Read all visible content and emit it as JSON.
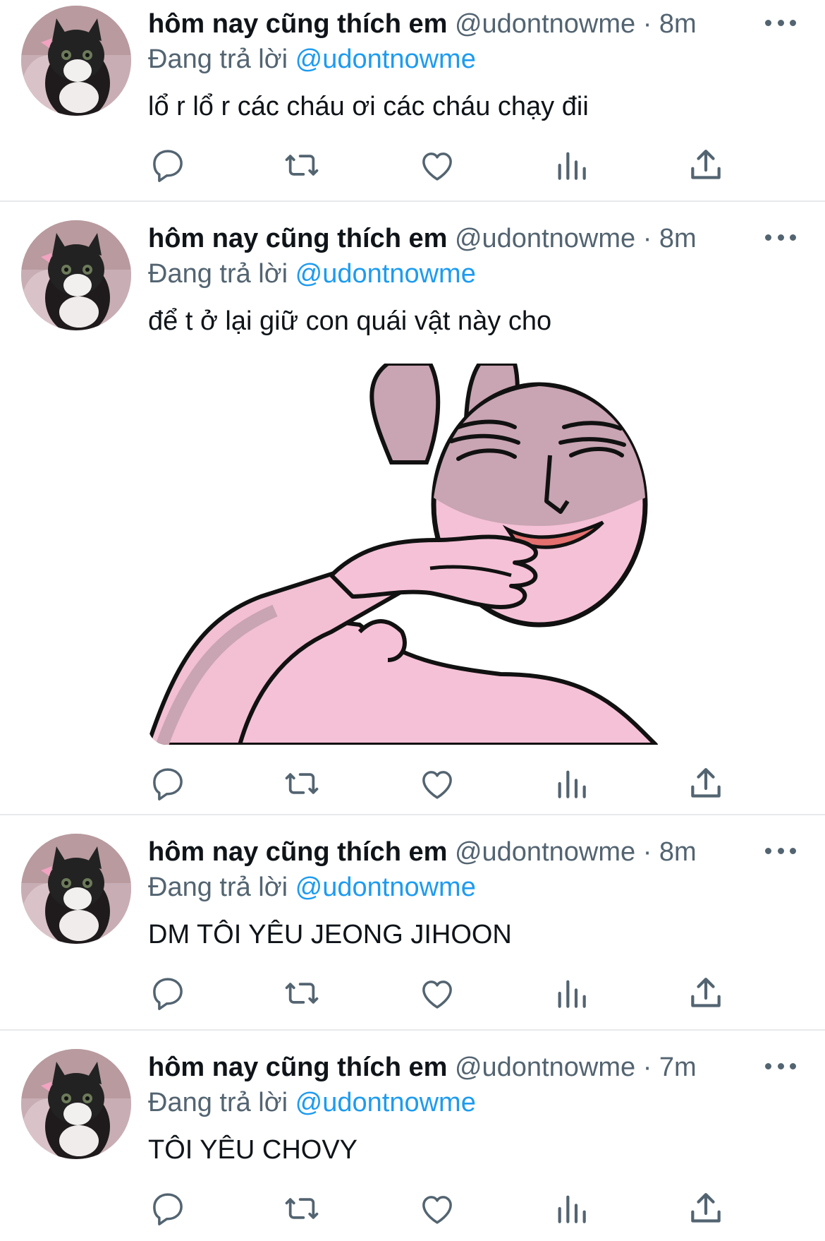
{
  "tweets": [
    {
      "display_name": "hôm nay cũng thích em",
      "handle": "@udontnowme",
      "separator": "·",
      "time": "8m",
      "replying_prefix": "Đang trả lời",
      "replying_to": "@udontnowme",
      "text": "lổ r lổ r các cháu ơi các cháu chạy đii",
      "has_media": false
    },
    {
      "display_name": "hôm nay cũng thích em",
      "handle": "@udontnowme",
      "separator": "·",
      "time": "8m",
      "replying_prefix": "Đang trả lời",
      "replying_to": "@udontnowme",
      "text": "để t ở lại giữ con quái vật này cho",
      "has_media": true,
      "media": "pink-bunny-sticker"
    },
    {
      "display_name": "hôm nay cũng thích em",
      "handle": "@udontnowme",
      "separator": "·",
      "time": "8m",
      "replying_prefix": "Đang trả lời",
      "replying_to": "@udontnowme",
      "text": "DM TÔI YÊU JEONG JIHOON",
      "has_media": false
    },
    {
      "display_name": "hôm nay cũng thích em",
      "handle": "@udontnowme",
      "separator": "·",
      "time": "7m",
      "replying_prefix": "Đang trả lời",
      "replying_to": "@udontnowme",
      "text": "TÔI YÊU CHOVY",
      "has_media": false
    }
  ],
  "action_icons": [
    "reply-icon",
    "retweet-icon",
    "like-icon",
    "analytics-icon",
    "share-icon"
  ],
  "colors": {
    "link": "#1d9bf0",
    "secondary_text": "#536471",
    "primary_text": "#0f1419",
    "divider": "#e7e9ec",
    "sticker_pink": "#f5c1d6",
    "sticker_shadow": "#c9a4b2"
  }
}
